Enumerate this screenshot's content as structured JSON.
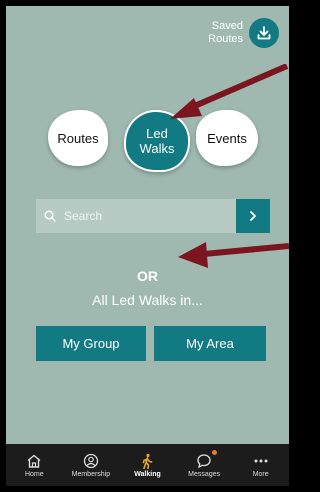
{
  "header": {
    "saved_routes_line1": "Saved",
    "saved_routes_line2": "Routes",
    "saved_icon": "download-icon"
  },
  "categories": {
    "routes": "Routes",
    "led_walks_line1": "Led",
    "led_walks_line2": "Walks",
    "events": "Events"
  },
  "search": {
    "placeholder": "Search",
    "search_icon": "search-icon",
    "go_icon": "chevron-right-icon"
  },
  "main": {
    "or": "OR",
    "all_led_walks": "All Led Walks in...",
    "my_group": "My Group",
    "my_area": "My Area"
  },
  "bottom_nav": {
    "items": [
      {
        "label": "Home",
        "icon": "home-icon"
      },
      {
        "label": "Membership",
        "icon": "membership-icon"
      },
      {
        "label": "Walking",
        "icon": "walking-icon"
      },
      {
        "label": "Messages",
        "icon": "messages-icon"
      },
      {
        "label": "More",
        "icon": "more-icon"
      }
    ],
    "active": "Walking"
  },
  "colors": {
    "background": "#9fb9b0",
    "accent": "#117a83",
    "arrow": "#7b1620",
    "walking_active": "#e8a52c",
    "notification_dot": "#e87b2c"
  }
}
